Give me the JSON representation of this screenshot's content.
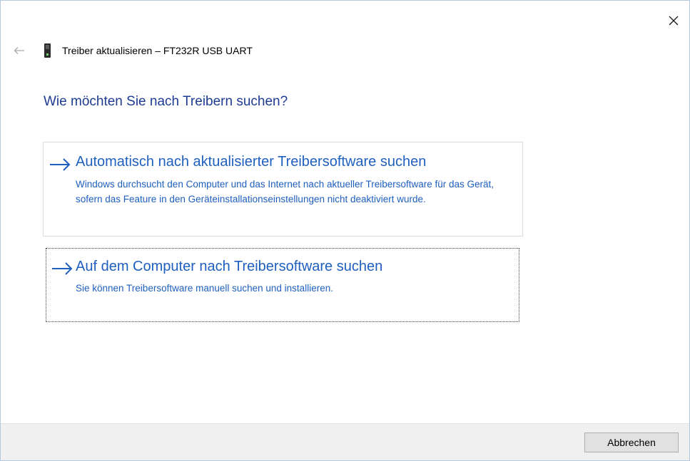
{
  "window": {
    "title": "Treiber aktualisieren – FT232R USB UART",
    "close_icon": "close-icon",
    "back_icon": "back-arrow-icon",
    "device_icon": "usb-device-icon"
  },
  "main": {
    "question": "Wie möchten Sie nach Treibern suchen?",
    "options": [
      {
        "title": "Automatisch nach aktualisierter Treibersoftware suchen",
        "description": "Windows durchsucht den Computer und das Internet nach aktueller Treibersoftware für das Gerät, sofern das Feature in den Geräteinstallationseinstellungen nicht deaktiviert wurde.",
        "icon": "arrow-right-icon"
      },
      {
        "title": "Auf dem Computer nach Treibersoftware suchen",
        "description": "Sie können Treibersoftware manuell suchen und installieren.",
        "icon": "arrow-right-icon"
      }
    ]
  },
  "footer": {
    "cancel_label": "Abbrechen"
  },
  "colors": {
    "heading": "#1e3b92",
    "link": "#1f5fbf",
    "footer_bg": "#f0f0f0",
    "button_bg": "#e1e1e1"
  }
}
